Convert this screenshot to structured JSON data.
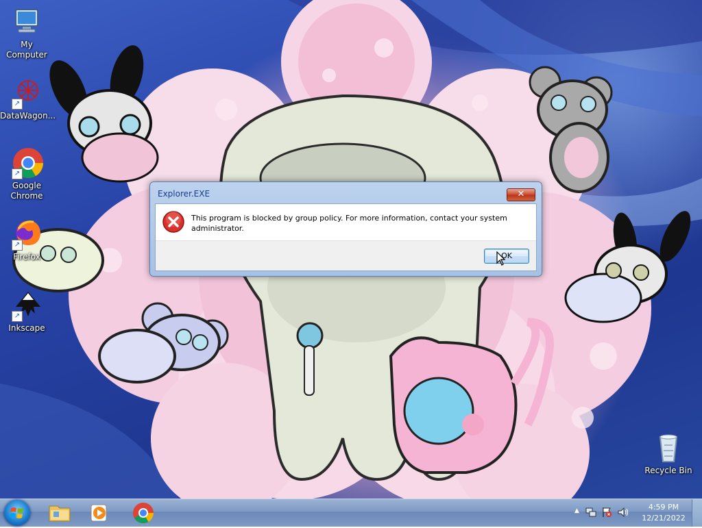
{
  "desktop": {
    "icons": [
      {
        "label": "My Computer",
        "icon": "computer-icon"
      },
      {
        "label": "DataWagon...",
        "icon": "datawagon-icon"
      },
      {
        "label": "Google Chrome",
        "icon": "chrome-icon"
      },
      {
        "label": "Firefox",
        "icon": "firefox-icon"
      },
      {
        "label": "Inkscape",
        "icon": "inkscape-icon"
      },
      {
        "label": "Recycle Bin",
        "icon": "recycle-bin-icon"
      }
    ]
  },
  "dialog": {
    "title": "Explorer.EXE",
    "close_glyph": "✕",
    "message": "This program is blocked by group policy. For more information, contact your system administrator.",
    "ok_label": "OK",
    "icon": "error-icon"
  },
  "taskbar": {
    "start_icon": "windows-start-icon",
    "pinned": [
      {
        "name": "file-explorer-icon"
      },
      {
        "name": "media-player-icon"
      },
      {
        "name": "chrome-icon"
      }
    ],
    "tray": {
      "show_hidden_glyph": "▲",
      "icons": [
        "network-icon",
        "action-center-flag-icon",
        "volume-icon"
      ],
      "time": "4:59 PM",
      "date": "12/21/2022"
    }
  },
  "colors": {
    "dialog_title": "#163a8c",
    "close_button": "#c9482b",
    "error_red": "#d9302c",
    "taskbar": "#7e9ac4"
  }
}
